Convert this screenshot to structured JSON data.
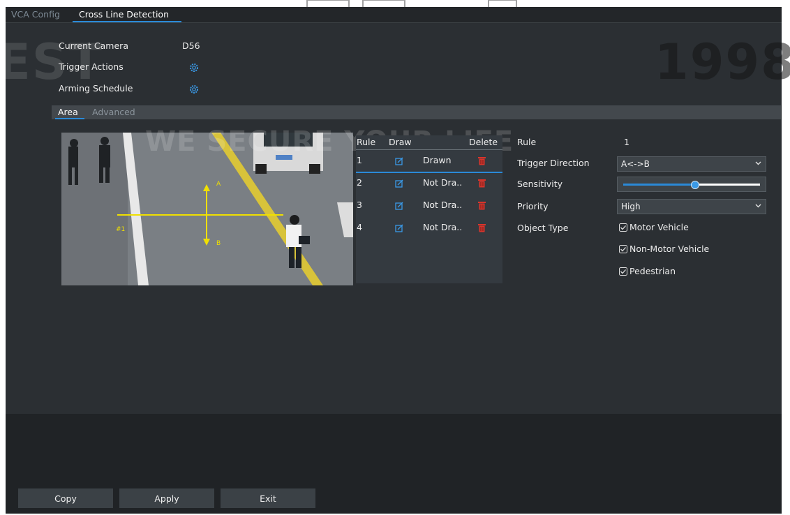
{
  "tabs": [
    {
      "label": "VCA Config"
    },
    {
      "label": "Cross Line Detection"
    }
  ],
  "current_camera": {
    "label": "Current Camera",
    "value": "D56"
  },
  "trigger_actions": {
    "label": "Trigger Actions",
    "icon": "gear-icon"
  },
  "arming_schedule": {
    "label": "Arming Schedule",
    "icon": "gear-icon"
  },
  "sub_tabs": [
    {
      "label": "Area"
    },
    {
      "label": "Advanced"
    }
  ],
  "video": {
    "line_label": "#1",
    "side_a": "A",
    "side_b": "B"
  },
  "rule_table": {
    "headers": {
      "rule": "Rule",
      "draw": "Draw",
      "delete": "Delete"
    },
    "rows": [
      {
        "rule": "1",
        "status": "Drawn"
      },
      {
        "rule": "2",
        "status": "Not Dra.."
      },
      {
        "rule": "3",
        "status": "Not Dra.."
      },
      {
        "rule": "4",
        "status": "Not Dra.."
      }
    ]
  },
  "props": {
    "rule": {
      "label": "Rule",
      "value": "1"
    },
    "trigger_direction": {
      "label": "Trigger Direction",
      "value": "A<->B"
    },
    "sensitivity": {
      "label": "Sensitivity",
      "level": 0.52
    },
    "priority": {
      "label": "Priority",
      "value": "High"
    },
    "object_type": {
      "label": "Object Type",
      "options": [
        {
          "label": "Motor Vehicle",
          "checked": true
        },
        {
          "label": "Non-Motor Vehicle",
          "checked": true
        },
        {
          "label": "Pedestrian",
          "checked": true
        }
      ]
    }
  },
  "buttons": {
    "copy": "Copy",
    "apply": "Apply",
    "exit": "Exit"
  },
  "watermark": {
    "year": "1998",
    "left_text": "EST",
    "slogan": "WE SECURE YOUR LIFE"
  },
  "colors": {
    "accent": "#2a8ad8",
    "delete": "#d9342b",
    "line": "#f0e000"
  }
}
